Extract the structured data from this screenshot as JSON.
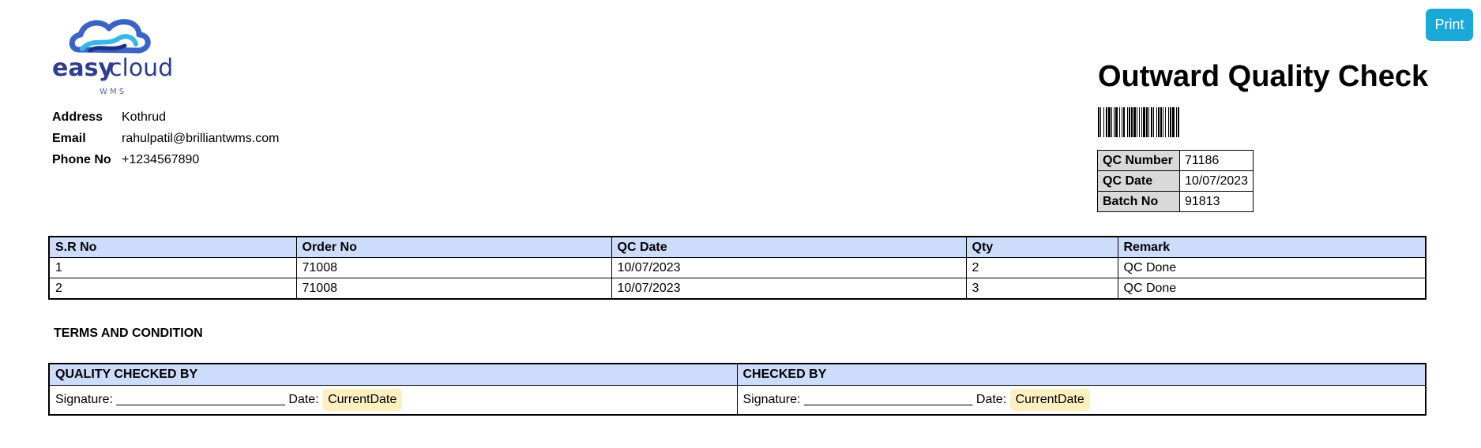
{
  "print_button": "Print",
  "logo": {
    "word_easy": "easy",
    "word_cloud": "cloud",
    "tagline": "W M S"
  },
  "company": [
    {
      "label": "Address",
      "value": "Kothrud"
    },
    {
      "label": "Email",
      "value": "rahulpatil@brilliantwms.com"
    },
    {
      "label": "Phone No",
      "value": "+1234567890"
    }
  ],
  "title": "Outward Quality Check",
  "meta": [
    {
      "label": "QC Number",
      "value": "71186"
    },
    {
      "label": "QC Date",
      "value": "10/07/2023"
    },
    {
      "label": "Batch No",
      "value": "91813"
    }
  ],
  "items": {
    "headers": [
      "S.R No",
      "Order No",
      "QC Date",
      "Qty",
      "Remark"
    ],
    "rows": [
      [
        "1",
        "71008",
        "10/07/2023",
        "2",
        "QC Done"
      ],
      [
        "2",
        "71008",
        "10/07/2023",
        "3",
        "QC Done"
      ]
    ]
  },
  "terms_heading": "TERMS AND CONDITION",
  "signoff": {
    "headers": [
      "QUALITY CHECKED BY",
      "CHECKED BY"
    ],
    "signature_text": "Signature: ________________________ Date:",
    "date_value": "CurrentDate"
  },
  "colors": {
    "header_bg": "#cddcfb",
    "meta_label_bg": "#d9d9d9",
    "print_button": "#1aa8d9",
    "date_chip": "#fff1bf",
    "logo_blue": "#2f3d8f"
  }
}
